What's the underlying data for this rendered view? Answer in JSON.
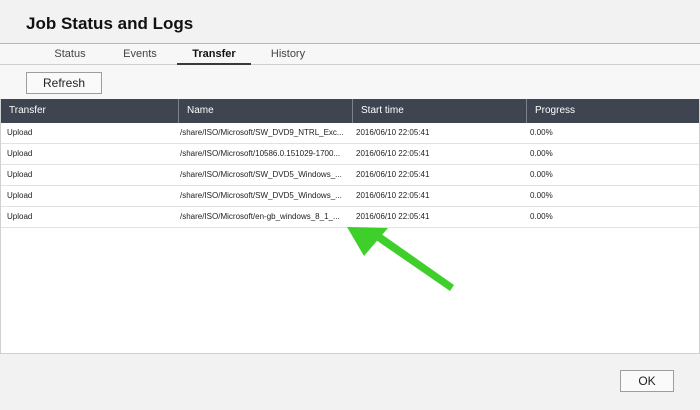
{
  "window": {
    "title": "Job Status and Logs"
  },
  "tabs": [
    {
      "label": "Status"
    },
    {
      "label": "Events"
    },
    {
      "label": "Transfer"
    },
    {
      "label": "History"
    }
  ],
  "toolbar": {
    "refresh_label": "Refresh"
  },
  "table": {
    "headers": [
      "Transfer",
      "Name",
      "Start time",
      "Progress"
    ],
    "rows": [
      {
        "transfer": "Upload",
        "name": "/share/ISO/Microsoft/SW_DVD9_NTRL_Exc...",
        "start_time": "2016/06/10 22:05:41",
        "progress": "0.00%"
      },
      {
        "transfer": "Upload",
        "name": "/share/ISO/Microsoft/10586.0.151029-1700...",
        "start_time": "2016/06/10 22:05:41",
        "progress": "0.00%"
      },
      {
        "transfer": "Upload",
        "name": "/share/ISO/Microsoft/SW_DVD5_Windows_...",
        "start_time": "2016/06/10 22:05:41",
        "progress": "0.00%"
      },
      {
        "transfer": "Upload",
        "name": "/share/ISO/Microsoft/SW_DVD5_Windows_...",
        "start_time": "2016/06/10 22:05:41",
        "progress": "0.00%"
      },
      {
        "transfer": "Upload",
        "name": "/share/ISO/Microsoft/en-gb_windows_8_1_...",
        "start_time": "2016/06/10 22:05:41",
        "progress": "0.00%"
      }
    ]
  },
  "footer": {
    "ok_label": "OK"
  },
  "annotation": {
    "icon": "green-arrow-icon",
    "color": "#3ecf2a"
  },
  "colors": {
    "header_bg": "#3e4450",
    "chrome_bg": "#f2f2f2"
  }
}
